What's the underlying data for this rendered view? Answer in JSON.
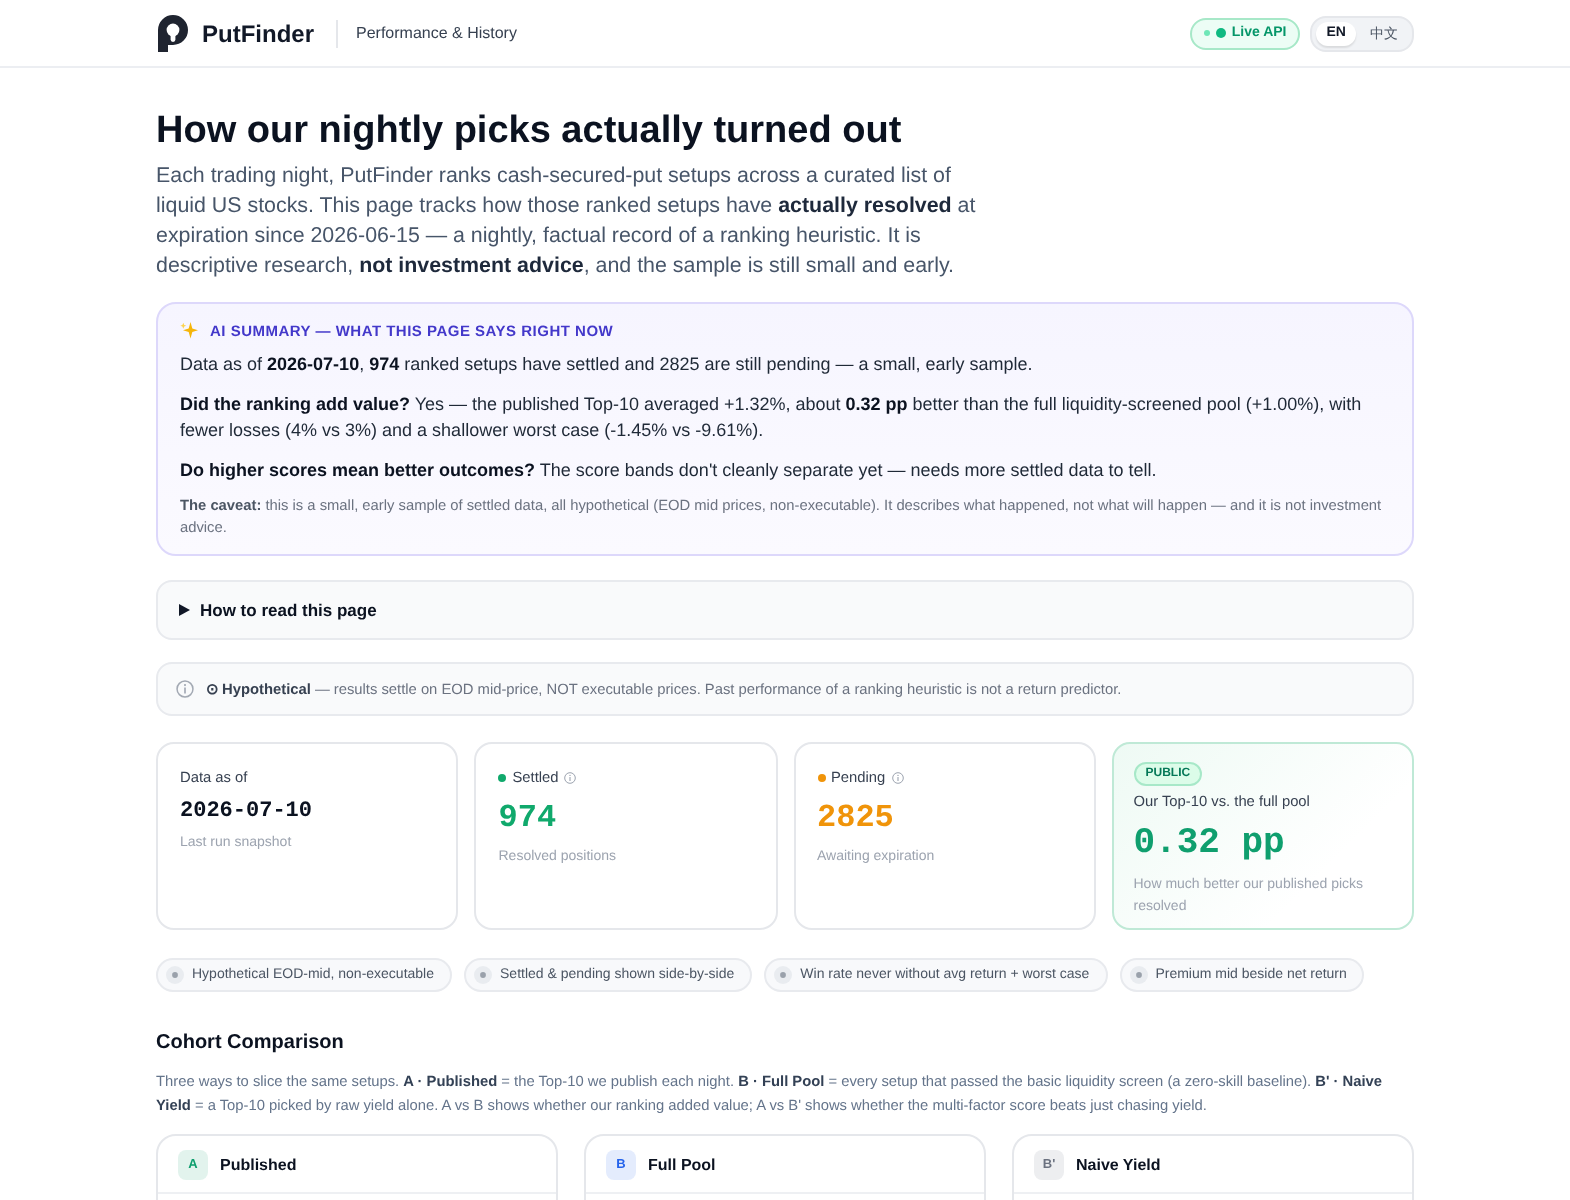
{
  "header": {
    "brand": "PutFinder",
    "section": "Performance & History",
    "status": {
      "label": "Live API",
      "on": true
    },
    "languages": [
      {
        "label": "EN",
        "selected": true
      },
      {
        "label": "中文",
        "selected": false
      }
    ]
  },
  "intro": {
    "title": "How our nightly picks actually turned out",
    "text": "Each trading night, PutFinder ranks cash-secured-put setups across a curated list of liquid US stocks. This page tracks how those ranked setups have **actually resolved** at expiration since 2026-06-15 — a nightly, factual record of a ranking heuristic. It is descriptive research, **not investment advice**, and the sample is still small and early."
  },
  "ai_summary": {
    "heading": "AI SUMMARY — WHAT THIS PAGE SAYS RIGHT NOW",
    "paragraphs": [
      "Data as of **2026-07-10**, **974** ranked setups have settled and 2825 are still pending — a small, early sample.",
      "**Did the ranking add value?** Yes — the published Top-10 averaged +1.32%, about **0.32 pp** better than the full liquidity-screened pool (+1.00%), with fewer losses (4% vs 3%) and a shallower worst case (-1.45% vs -9.61%).",
      "**Do higher scores mean better outcomes?** The score bands don't cleanly separate yet — needs more settled data to tell."
    ],
    "caveat": "**The caveat:** this is a small, early sample of settled data, all hypothetical (EOD mid prices, non-executable). It describes what happened, not what will happen — and it is not investment advice."
  },
  "how_to_read": {
    "label": "How to read this page",
    "expanded": false
  },
  "notice": {
    "text": "**⊙ Hypothetical** — results settle on EOD mid-price, NOT executable prices. Past performance of a ranking heuristic is not a return predictor."
  },
  "stats": [
    {
      "kind": "date",
      "label": "Data as of",
      "value": "2026-07-10",
      "note": "Last run snapshot"
    },
    {
      "kind": "stat",
      "label": "Settled",
      "value": "974",
      "note": "Resolved positions",
      "color": "#10a96c"
    },
    {
      "kind": "stat",
      "label": "Pending",
      "value": "2825",
      "note": "Awaiting expiration",
      "color": "#f0940a"
    },
    {
      "kind": "highlight",
      "badge": "PUBLIC",
      "label": "Our Top-10 vs. the full pool",
      "value": "0.32 pp",
      "note": "How much better our published picks resolved"
    }
  ],
  "principles": [
    "Hypothetical EOD-mid, non-executable",
    "Settled & pending shown side-by-side",
    "Win rate never without avg return + worst case",
    "Premium mid beside net return"
  ],
  "cohorts": {
    "title": "Cohort Comparison",
    "text": "Three ways to slice the same setups. **A · Published** = the Top-10 we publish each night. **B · Full Pool** = every setup that passed the basic liquidity screen (a zero-skill baseline). **B' · Naive Yield** = a Top-10 picked by raw yield alone. A vs B shows whether our ranking added value; A vs B' shows whether the multi-factor score beats just chasing yield.",
    "items": [
      {
        "letter": "A",
        "name": "Published",
        "color": "#0f9f6e"
      },
      {
        "letter": "B",
        "name": "Full Pool",
        "color": "#2563eb"
      },
      {
        "letter": "B'",
        "name": "Naive Yield",
        "color": "#6b7280"
      }
    ]
  }
}
